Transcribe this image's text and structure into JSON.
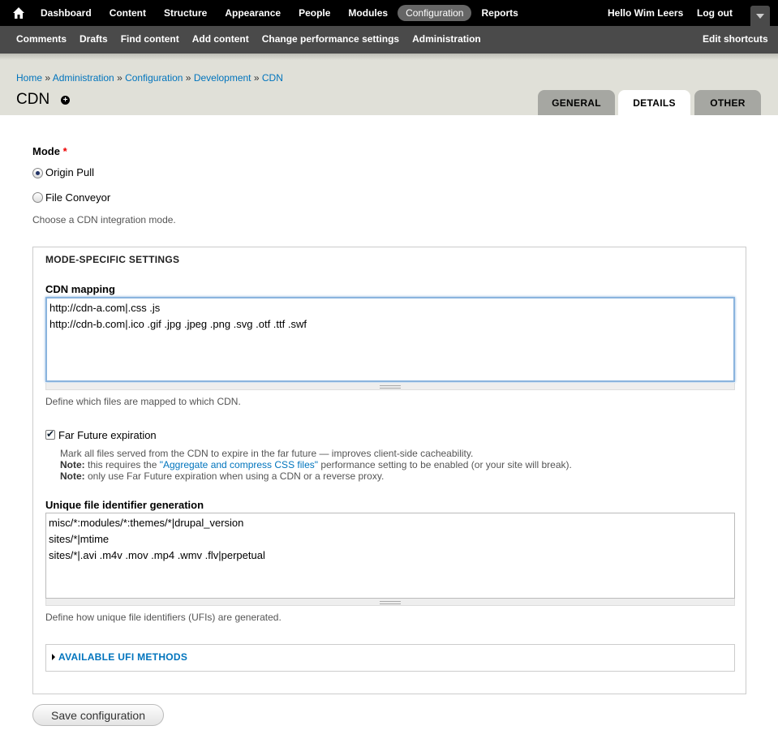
{
  "toolbar": {
    "menu": [
      "Dashboard",
      "Content",
      "Structure",
      "Appearance",
      "People",
      "Modules",
      "Configuration",
      "Reports"
    ],
    "active": "Configuration",
    "user": "Hello Wim Leers",
    "logout": "Log out"
  },
  "shortcuts": {
    "items": [
      "Comments",
      "Drafts",
      "Find content",
      "Add content",
      "Change performance settings",
      "Administration"
    ],
    "edit": "Edit shortcuts"
  },
  "breadcrumb": [
    "Home",
    "Administration",
    "Configuration",
    "Development",
    "CDN"
  ],
  "page_title": "CDN",
  "tabs": [
    "GENERAL",
    "DETAILS",
    "OTHER"
  ],
  "active_tab": "DETAILS",
  "mode": {
    "label": "Mode",
    "required": "*",
    "options": [
      "Origin Pull",
      "File Conveyor"
    ],
    "selected": "Origin Pull",
    "description": "Choose a CDN integration mode."
  },
  "fieldset": {
    "legend": "MODE-SPECIFIC SETTINGS",
    "cdn_mapping": {
      "label": "CDN mapping",
      "value": "http://cdn-a.com|.css .js\nhttp://cdn-b.com|.ico .gif .jpg .jpeg .png .svg .otf .ttf .swf",
      "description": "Define which files are mapped to which CDN."
    },
    "far_future": {
      "label": "Far Future expiration",
      "checked": true,
      "line1": "Mark all files served from the CDN to expire in the far future — improves client-side cacheability.",
      "note_label": "Note:",
      "line2_pre": " this requires the ",
      "line2_link": "\"Aggregate and compress CSS files\"",
      "line2_post": " performance setting to be enabled (or your site will break).",
      "line3": " only use Far Future expiration when using a CDN or a reverse proxy."
    },
    "ufi": {
      "label": "Unique file identifier generation",
      "value": "misc/*:modules/*:themes/*|drupal_version\nsites/*|mtime\nsites/*|.avi .m4v .mov .mp4 .wmv .flv|perpetual",
      "description": "Define how unique file identifiers (UFIs) are generated."
    },
    "available_methods": "AVAILABLE UFI METHODS"
  },
  "save_button": "Save configuration"
}
